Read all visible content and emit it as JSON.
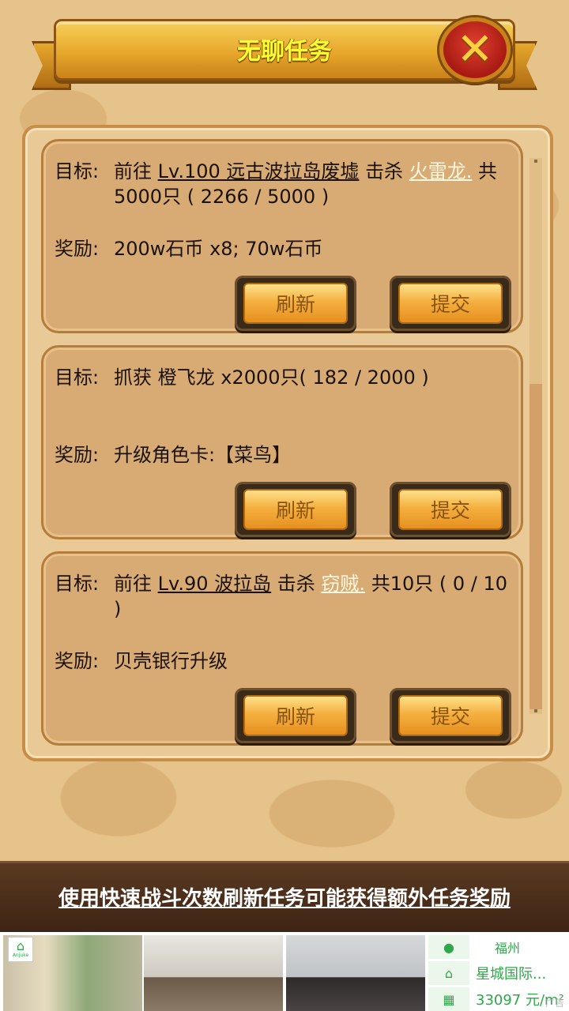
{
  "window": {
    "title": "无聊任务"
  },
  "tasks": [
    {
      "goal_label": "目标:",
      "goal_prefix": "前往",
      "location": "Lv.100 远古波拉岛废墟",
      "action": "击杀",
      "monster": "火雷龙.",
      "goal_suffix": "共5000只 ( 2266 / 5000 )",
      "reward_label": "奖励:",
      "reward": "200w石币 x8; 70w石币",
      "refresh_label": "刷新",
      "submit_label": "提交"
    },
    {
      "goal_label": "目标:",
      "goal_text": "抓获 橙飞龙 x2000只( 182 / 2000 )",
      "reward_label": "奖励:",
      "reward": "升级角色卡:【菜鸟】",
      "refresh_label": "刷新",
      "submit_label": "提交"
    },
    {
      "goal_label": "目标:",
      "goal_prefix": "前往",
      "location": "Lv.90 波拉岛",
      "action": "击杀",
      "monster": "窃贼.",
      "goal_suffix": " 共10只 ( 0 / 10 )",
      "reward_label": "奖励:",
      "reward": "贝壳银行升级",
      "refresh_label": "刷新",
      "submit_label": "提交"
    }
  ],
  "tip": {
    "text": "使用快速战斗次数刷新任务可能获得额外任务奖励"
  },
  "ad": {
    "logo_label": "Anjuke",
    "city": "福州",
    "project": "星城国际...",
    "price": "33097 元/m²",
    "ad_mark": "广告",
    "icons": [
      "location-pin-icon",
      "home-icon",
      "calculator-icon"
    ]
  },
  "colors": {
    "title": "#ffff33",
    "monster_link": "#fff7e0",
    "ad_green": "#2ea84a"
  }
}
